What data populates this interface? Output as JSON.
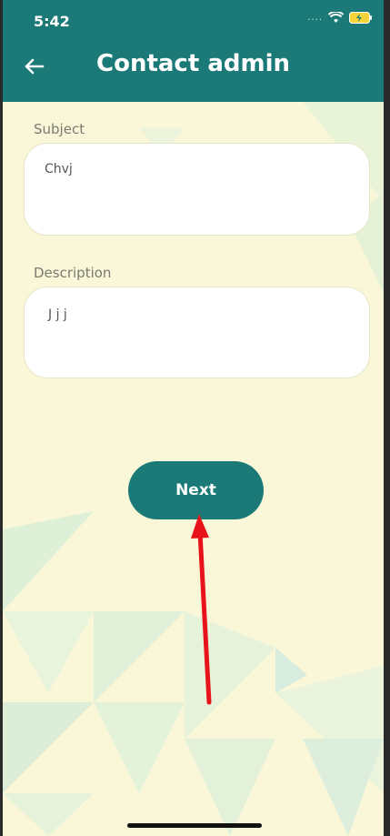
{
  "status_bar": {
    "time": "5:42",
    "signal": "....",
    "wifi_icon": "wifi-icon",
    "battery_icon": "battery-charging-icon"
  },
  "header": {
    "title": "Contact admin",
    "back_icon": "arrow-left-icon",
    "color": "#1b7a77"
  },
  "form": {
    "subject": {
      "label": "Subject",
      "value": "Chvj"
    },
    "description": {
      "label": "Description",
      "value": "J j j"
    }
  },
  "actions": {
    "next_label": "Next"
  },
  "annotation": {
    "type": "red-arrow",
    "points_to": "next-button",
    "color": "#e8121a"
  },
  "colors": {
    "background": "#faf7d9",
    "accent": "#1b7a77"
  }
}
